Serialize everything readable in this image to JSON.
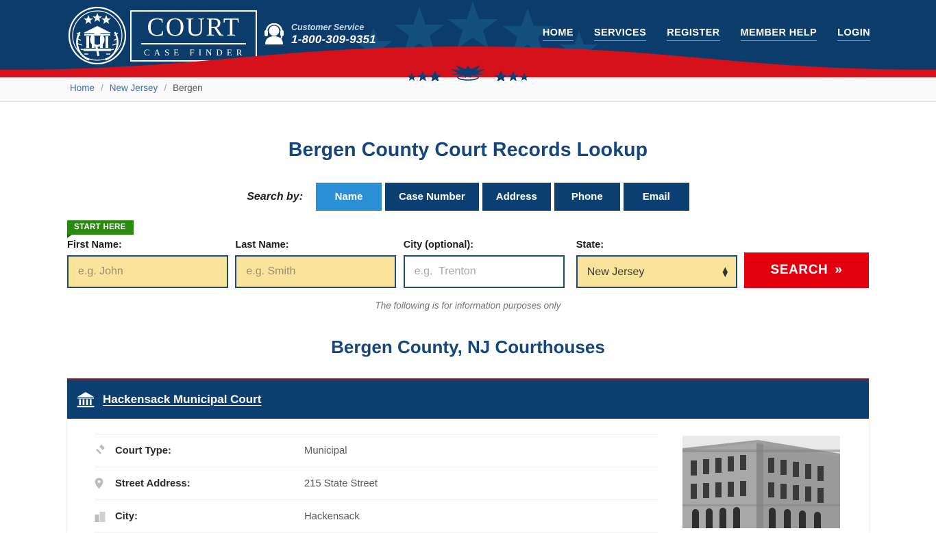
{
  "header": {
    "logo": {
      "icon": "court-seal-icon",
      "main": "COURT",
      "sub": "CASE FINDER"
    },
    "customer_service": {
      "icon": "headset-support-icon",
      "label": "Customer Service",
      "phone": "1-800-309-9351"
    },
    "nav": [
      {
        "label": "HOME"
      },
      {
        "label": "SERVICES"
      },
      {
        "label": "REGISTER"
      },
      {
        "label": "MEMBER HELP"
      },
      {
        "label": "LOGIN"
      }
    ],
    "colors": {
      "navy": "#0b3c6b",
      "red": "#d5111b",
      "white": "#ffffff"
    }
  },
  "breadcrumb": {
    "items": [
      {
        "label": "Home",
        "current": false
      },
      {
        "label": "New Jersey",
        "current": false
      },
      {
        "label": "Bergen",
        "current": true
      }
    ],
    "separator": "/"
  },
  "main": {
    "title": "Bergen County Court Records Lookup",
    "search_by_label": "Search by:",
    "tabs": [
      {
        "label": "Name",
        "active": true
      },
      {
        "label": "Case Number",
        "active": false
      },
      {
        "label": "Address",
        "active": false
      },
      {
        "label": "Phone",
        "active": false
      },
      {
        "label": "Email",
        "active": false
      }
    ],
    "start_badge": "START HERE",
    "form": {
      "first_name": {
        "label": "First Name:",
        "placeholder": "e.g. John",
        "value": ""
      },
      "last_name": {
        "label": "Last Name:",
        "placeholder": "e.g. Smith",
        "value": ""
      },
      "city": {
        "label": "City (optional):",
        "placeholder": "e.g.  Trenton",
        "value": ""
      },
      "state": {
        "label": "State:",
        "value": "New Jersey",
        "options": [
          "New Jersey"
        ]
      },
      "search_button": "SEARCH",
      "search_button_chevron": "»"
    },
    "info_note": "The following is for information purposes only",
    "courthouses_title": "Bergen County, NJ Courthouses"
  },
  "courthouse_card": {
    "icon": "bank-courthouse-icon",
    "name": "Hackensack Municipal Court",
    "accent_color": "#8f1720",
    "header_color": "#0d3f72",
    "rows": [
      {
        "icon": "gavel-icon",
        "label": "Court Type:",
        "value": "Municipal"
      },
      {
        "icon": "map-pin-icon",
        "label": "Street Address:",
        "value": "215 State Street"
      },
      {
        "icon": "city-icon",
        "label": "City:",
        "value": "Hackensack"
      }
    ],
    "photo_alt": "courthouse-building-photo"
  }
}
